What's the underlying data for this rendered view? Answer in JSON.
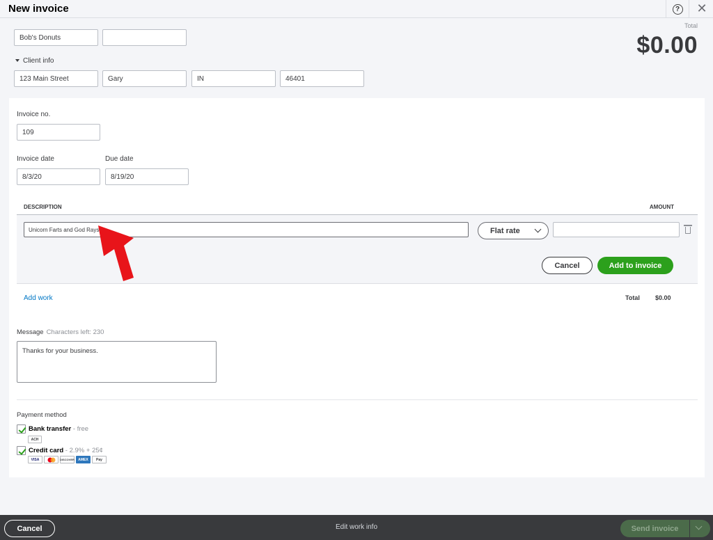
{
  "window": {
    "title": "New invoice",
    "help_glyph": "?",
    "close_glyph": "✕"
  },
  "customer": {
    "name": "Bob's Donuts",
    "email": "",
    "client_info_label": "Client info",
    "street": "123 Main Street",
    "city": "Gary",
    "state": "IN",
    "zip": "46401"
  },
  "summary": {
    "total_label": "Total",
    "total_amount": "$0.00"
  },
  "invoice": {
    "number_label": "Invoice no.",
    "number": "109",
    "date_label": "Invoice date",
    "date": "8/3/20",
    "due_label": "Due date",
    "due": "8/19/20"
  },
  "table": {
    "description_header": "DESCRIPTION",
    "amount_header": "AMOUNT",
    "line_description": "Unicorn Farts and God Rays",
    "rate_type": "Flat rate",
    "amount": "",
    "cancel_label": "Cancel",
    "add_label": "Add to invoice"
  },
  "annotation": {
    "arrow_color": "#e8141a"
  },
  "work": {
    "add_work_label": "Add work",
    "total_label": "Total",
    "total_amount": "$0.00"
  },
  "message": {
    "label": "Message",
    "chars_left": "Characters left: 230",
    "text": "Thanks for your business."
  },
  "payment": {
    "label": "Payment method",
    "bank_name": "Bank transfer",
    "bank_note": " - free",
    "bank_badge": "ACH",
    "card_name": "Credit card",
    "card_note": " - 2.9% + 25¢",
    "card_badges": [
      "VISA",
      "MC",
      "DISCOVER",
      "AMEX",
      "Pay"
    ]
  },
  "footer": {
    "cancel_label": "Cancel",
    "center_label": "Edit work info",
    "send_label": "Send invoice"
  },
  "colors": {
    "accent_green": "#2ca01c",
    "link_blue": "#0077c5",
    "footer_bg": "#393a3d"
  }
}
